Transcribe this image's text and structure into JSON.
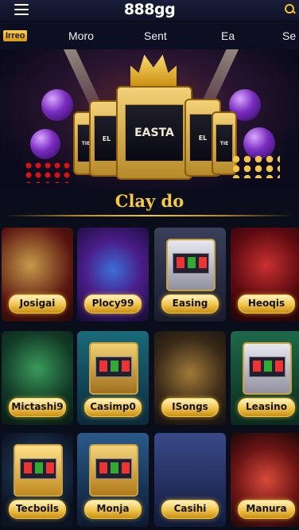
{
  "header": {
    "logo_text": "888gg",
    "menu_icon": "hamburger-icon",
    "search_icon": "search-icon"
  },
  "tabs": [
    {
      "label": "Irreo",
      "active": true
    },
    {
      "label": "Moro"
    },
    {
      "label": "Sent"
    },
    {
      "label": "Ea"
    },
    {
      "label": "Se"
    }
  ],
  "hero": {
    "machines": [
      {
        "text": "TIE"
      },
      {
        "text": "EL"
      },
      {
        "text": "EASTA"
      },
      {
        "text": "EL"
      },
      {
        "text": "TIE"
      }
    ]
  },
  "section": {
    "title": "Clay do"
  },
  "games": [
    {
      "label": "Josigai"
    },
    {
      "label": "Plocy99"
    },
    {
      "label": "Easing"
    },
    {
      "label": "Heoqis"
    },
    {
      "label": "Mictashi9"
    },
    {
      "label": "Casimp0"
    },
    {
      "label": "ISongs"
    },
    {
      "label": "Leasino"
    },
    {
      "label": "Tecboils"
    },
    {
      "label": "Monja"
    },
    {
      "label": "Casihi"
    },
    {
      "label": "Manura"
    }
  ],
  "colors": {
    "accent": "#f7c842",
    "background": "#0a0d1a"
  }
}
